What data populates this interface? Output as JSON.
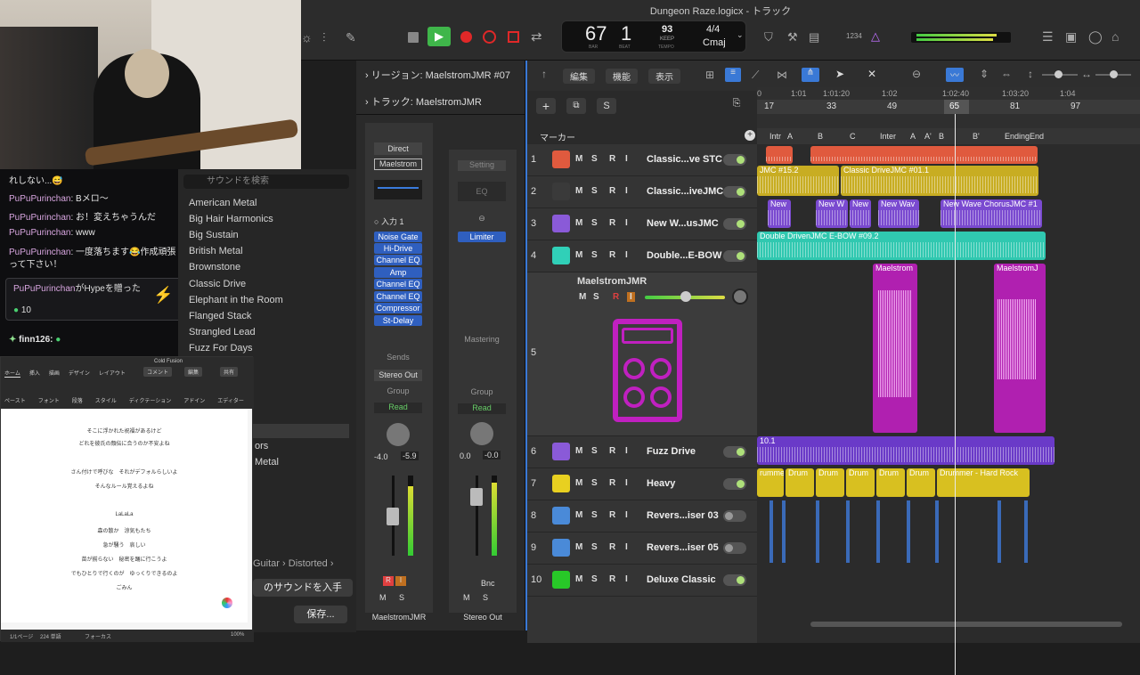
{
  "window": {
    "title": "Dungeon Raze.logicx - トラック"
  },
  "lcd": {
    "bar": "67",
    "beat": "1",
    "bar_label": "BAR",
    "beat_label": "BEAT",
    "tempo": "93",
    "tempo_mode": "KEEP",
    "tempo_label": "TEMPO",
    "signature": "4/4",
    "key": "Cmaj"
  },
  "chat": {
    "lines": [
      {
        "user": "",
        "text": "れしない...😅"
      },
      {
        "user": "PuPuPurinchan",
        "text": ": Bメロ〜"
      },
      {
        "user": "PuPuPurinchan",
        "text": ": お！変えちゃうんだ"
      },
      {
        "user": "PuPuPurinchan",
        "text": ": www"
      },
      {
        "user": "PuPuPurinchan",
        "text": ": 一度落ちます😂作成頑張って下さい！"
      }
    ],
    "hype_user": "PuPuPurinchan",
    "hype_text": "がHypeを贈った",
    "hype_count": "10",
    "last_user": "finn126:"
  },
  "library": {
    "search_placeholder": "サウンドを検索",
    "items": [
      "American Metal",
      "Big Hair Harmonics",
      "Big Sustain",
      "British Metal",
      "Brownstone",
      "Classic Drive",
      "Elephant in the Room",
      "Flanged Stack",
      "Strangled Lead",
      "Fuzz For Days"
    ],
    "items_lower": [
      "ors",
      "Metal"
    ],
    "breadcrumb": [
      "Guitar",
      "Distorted"
    ],
    "get_sounds": "のサウンドを入手",
    "save": "保存..."
  },
  "word": {
    "title": "Cold Fusion",
    "tabs": [
      "ホーム",
      "挿入",
      "描画",
      "デザイン",
      "レイアウト"
    ],
    "comment": "コメント",
    "edit": "編集",
    "share": "共有",
    "tools": [
      "ペースト",
      "フォント",
      "段落",
      "スタイル",
      "ディクテーション",
      "アドイン",
      "エディター"
    ],
    "lines": [
      "そこに浮かれた祝福があるけど",
      "どれを彼氏の顔伝に合うのか不安よね",
      "",
      "さん付けで呼びな　それがデフォルらしいよ",
      "そんなルール覚えるよね",
      "",
      "LaLaLa",
      "森の散か　涼気もたち",
      "急が騒う　哀しい",
      "苗が揃らない　秘密を踊に行こうよ",
      "でもひとりで行くのが　ゆっくりできるのよ",
      "ごみん"
    ],
    "status": [
      "1/1ページ",
      "224 単語",
      "フォーカス",
      "100%"
    ]
  },
  "inspector": {
    "region": "リージョン: MaelstromJMR #07",
    "track": "トラック: MaelstromJMR",
    "strip1": {
      "top": "Direct",
      "amp": "Maelstrom",
      "input": "入力 1",
      "plugins": [
        "Noise Gate",
        "Hi-Drive",
        "Channel EQ",
        "Amp",
        "Channel EQ",
        "Channel EQ",
        "Compressor",
        "St-Delay"
      ],
      "sends": "Sends",
      "output": "Stereo Out",
      "group": "Group",
      "auto": "Read",
      "vol": "-4.0",
      "peak": "-5.9",
      "name": "MaelstromJMR",
      "m": "M",
      "s": "S",
      "r": "R",
      "i": "I"
    },
    "strip2": {
      "top": "Setting",
      "eq": "EQ",
      "plugins": [
        "Limiter"
      ],
      "label": "Mastering",
      "group": "Group",
      "auto": "Read",
      "vol": "0.0",
      "peak": "-0.0",
      "name": "Stereo Out",
      "m": "M",
      "s": "S",
      "bnc": "Bnc"
    }
  },
  "trackarea": {
    "menus": [
      "編集",
      "機能",
      "表示"
    ],
    "marker_label": "マーカー",
    "ruler": [
      "1:01",
      "1:01:20",
      "1:02",
      "1:02:40",
      "1:03:20",
      "1:04"
    ],
    "bars": [
      "17",
      "33",
      "49",
      "65",
      "81",
      "97"
    ],
    "markers": [
      "Intr",
      "A",
      "B",
      "C",
      "Inter",
      "A",
      "A'",
      "B",
      "B'",
      "Ending",
      "End"
    ],
    "tracks": [
      {
        "num": "1",
        "name": "Classic...ve STC",
        "color": "#e05a3e",
        "on": true
      },
      {
        "num": "2",
        "name": "Classic...iveJMC",
        "color": "#3a3a3a",
        "on": true
      },
      {
        "num": "3",
        "name": "New W...usJMC",
        "color": "#8a5ad8",
        "on": true
      },
      {
        "num": "4",
        "name": "Double...E-BOW",
        "color": "#30d0b8",
        "on": true
      },
      {
        "num": "5",
        "name": "MaelstromJMR",
        "color": "#c020c0",
        "on": true
      },
      {
        "num": "6",
        "name": "Fuzz Drive",
        "color": "#8a5ad8",
        "on": true
      },
      {
        "num": "7",
        "name": "Heavy",
        "color": "#e8d020",
        "on": true
      },
      {
        "num": "8",
        "name": "Revers...iser 03",
        "color": "#4a8ad8",
        "on": false
      },
      {
        "num": "9",
        "name": "Revers...iser 05",
        "color": "#4a8ad8",
        "on": false
      },
      {
        "num": "10",
        "name": "Deluxe Classic",
        "color": "#28c828",
        "on": true
      }
    ],
    "regions": {
      "r2a": "JMC #15.2",
      "r2b": "Classic DriveJMC #01.1",
      "r3a": "New",
      "r3b": "New W",
      "r3c": "New",
      "r3d": "New Wav",
      "r3e": "New Wave ChorusJMC #1",
      "r4": "Double DrivenJMC E-BOW #09.2",
      "r5a": "Maelstrom",
      "r5b": "MaelstromJ",
      "r6": "10.1",
      "drums": [
        "rummer -",
        "Drum",
        "Drum",
        "Drum",
        "Drum",
        "Drum",
        "Drummer - Hard Rock"
      ]
    }
  }
}
